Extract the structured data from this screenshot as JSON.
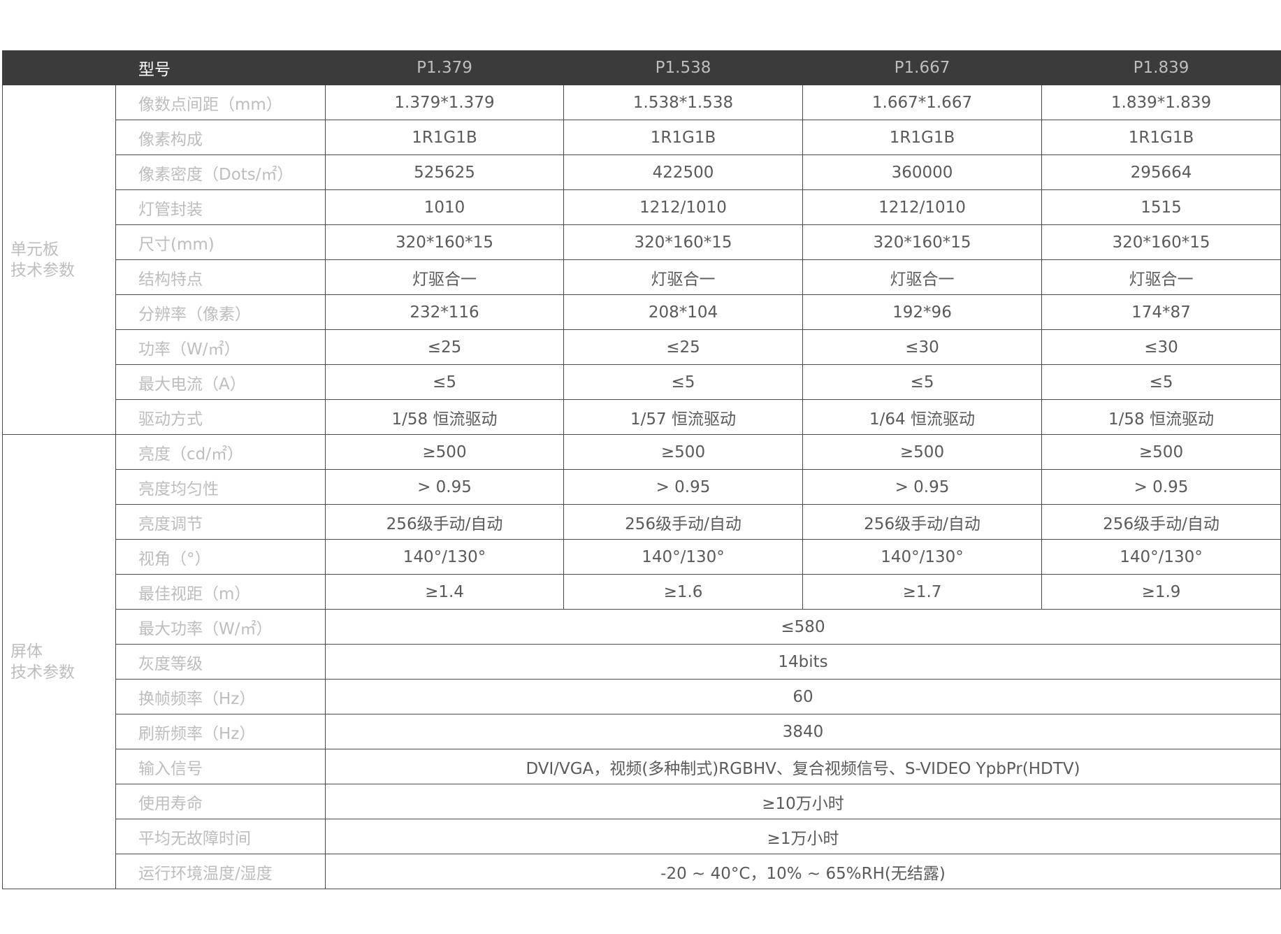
{
  "header": {
    "model_label": "型号",
    "models": [
      "P1.379",
      "P1.538",
      "P1.667",
      "P1.839"
    ]
  },
  "unit_board": {
    "group_label_line1": "单元板",
    "group_label_line2": "技术参数",
    "rows": [
      {
        "param": "像数点间距（mm）",
        "values": [
          "1.379*1.379",
          "1.538*1.538",
          "1.667*1.667",
          "1.839*1.839"
        ]
      },
      {
        "param": "像素构成",
        "values": [
          "1R1G1B",
          "1R1G1B",
          "1R1G1B",
          "1R1G1B"
        ]
      },
      {
        "param": "像素密度（Dots/㎡）",
        "values": [
          "525625",
          "422500",
          "360000",
          "295664"
        ]
      },
      {
        "param": "灯管封装",
        "values": [
          "1010",
          "1212/1010",
          "1212/1010",
          "1515"
        ]
      },
      {
        "param": "尺寸(mm)",
        "values": [
          "320*160*15",
          "320*160*15",
          "320*160*15",
          "320*160*15"
        ]
      },
      {
        "param": "结构特点",
        "values": [
          "灯驱合一",
          "灯驱合一",
          "灯驱合一",
          "灯驱合一"
        ]
      },
      {
        "param": "分辨率（像素）",
        "values": [
          "232*116",
          "208*104",
          "192*96",
          "174*87"
        ]
      },
      {
        "param": "功率（W/㎡）",
        "values": [
          "≤25",
          "≤25",
          "≤30",
          "≤30"
        ]
      },
      {
        "param": "最大电流（A）",
        "values": [
          "≤5",
          "≤5",
          "≤5",
          "≤5"
        ]
      },
      {
        "param": "驱动方式",
        "values": [
          "1/58 恒流驱动",
          "1/57 恒流驱动",
          "1/64 恒流驱动",
          "1/58 恒流驱动"
        ]
      }
    ]
  },
  "screen": {
    "group_label_line1": "屏体",
    "group_label_line2": "技术参数",
    "rows": [
      {
        "param": "亮度（cd/㎡）",
        "values": [
          "≥500",
          "≥500",
          "≥500",
          "≥500"
        ]
      },
      {
        "param": "亮度均匀性",
        "values": [
          "> 0.95",
          "> 0.95",
          "> 0.95",
          "> 0.95"
        ]
      },
      {
        "param": "亮度调节",
        "values": [
          "256级手动/自动",
          "256级手动/自动",
          "256级手动/自动",
          "256级手动/自动"
        ]
      },
      {
        "param": "视角（°）",
        "values": [
          "140°/130°",
          "140°/130°",
          "140°/130°",
          "140°/130°"
        ]
      },
      {
        "param": "最佳视距（m）",
        "values": [
          "≥1.4",
          "≥1.6",
          "≥1.7",
          "≥1.9"
        ]
      }
    ],
    "merged_rows": [
      {
        "param": "最大功率（W/㎡）",
        "value": "≤580"
      },
      {
        "param": "灰度等级",
        "value": "14bits"
      },
      {
        "param": "换帧频率（Hz）",
        "value": "60"
      },
      {
        "param": "刷新频率（Hz）",
        "value": "3840"
      },
      {
        "param": "输入信号",
        "value": "DVI/VGA，视频(多种制式)RGBHV、复合视频信号、S-VIDEO YpbPr(HDTV)"
      },
      {
        "param": "使用寿命",
        "value": "≥10万小时"
      },
      {
        "param": "平均无故障时间",
        "value": "≥1万小时"
      },
      {
        "param": "运行环境温度/湿度",
        "value": "-20 ~ 40°C，10% ~ 65%RH(无结露)"
      }
    ]
  }
}
